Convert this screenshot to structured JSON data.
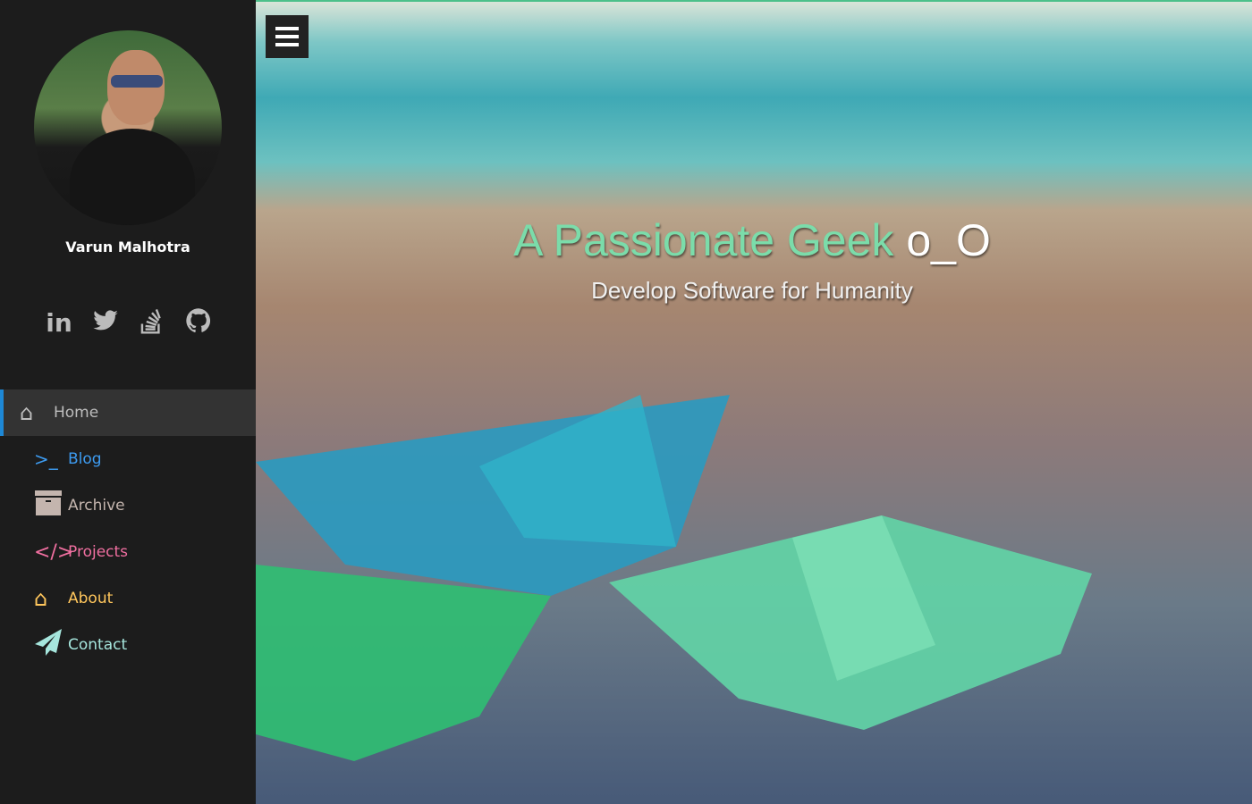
{
  "sidebar": {
    "name": "Varun Malhotra",
    "social": [
      {
        "icon": "linkedin-icon",
        "label": "in"
      },
      {
        "icon": "twitter-icon"
      },
      {
        "icon": "stackoverflow-icon"
      },
      {
        "icon": "github-icon"
      }
    ],
    "nav": [
      {
        "label": "Home",
        "icon": "home-icon",
        "color": "#bdbdbd",
        "active": true
      },
      {
        "label": "Blog",
        "icon": "terminal-icon",
        "color": "#3d9bf0"
      },
      {
        "label": "Archive",
        "icon": "archive-icon",
        "color": "#c4b5ae"
      },
      {
        "label": "Projects",
        "icon": "code-icon",
        "color": "#f06fa0"
      },
      {
        "label": "About",
        "icon": "home-icon",
        "color": "#ffc65c"
      },
      {
        "label": "Contact",
        "icon": "paper-plane-icon",
        "color": "#a6e6dd"
      }
    ]
  },
  "hero": {
    "title": "A Passionate Geek",
    "title_suffix": "o_O",
    "subtitle": "Develop Software for Humanity"
  },
  "colors": {
    "accent": "#7bdcaa",
    "active_border": "#1e88d6"
  }
}
